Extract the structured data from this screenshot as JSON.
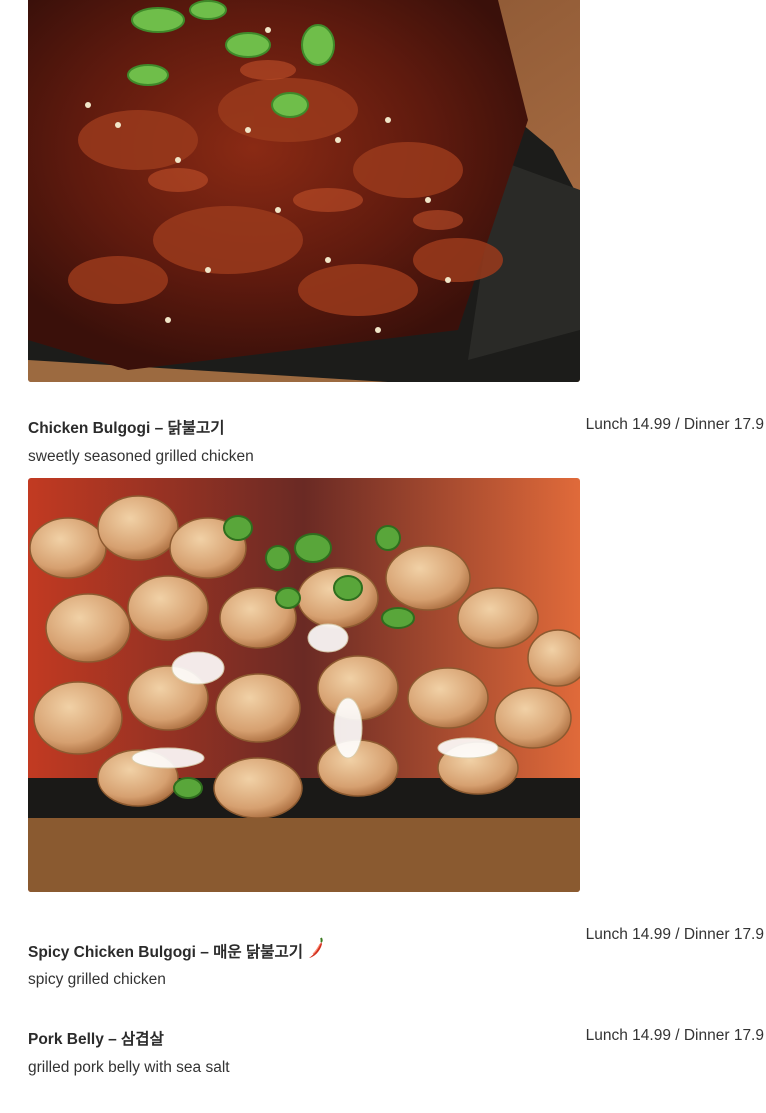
{
  "menu": {
    "items": [
      {
        "name": "Chicken Bulgogi – 닭불고기",
        "price": "Lunch 14.99 / Dinner 17.9",
        "description": "sweetly seasoned grilled chicken"
      },
      {
        "name": "Spicy Chicken Bulgogi – 매운 닭불고기",
        "spicy_icon": "chili-pepper-icon",
        "price": "Lunch 14.99 / Dinner 17.9",
        "description": "spicy grilled chicken"
      },
      {
        "name": "Pork Belly – 삼겹살",
        "price": "Lunch 14.99 / Dinner 17.9",
        "description": "grilled pork belly with sea salt"
      }
    ]
  },
  "colors": {
    "text": "#333333",
    "title": "#2b2b2b",
    "chili": "#d32f1e"
  }
}
